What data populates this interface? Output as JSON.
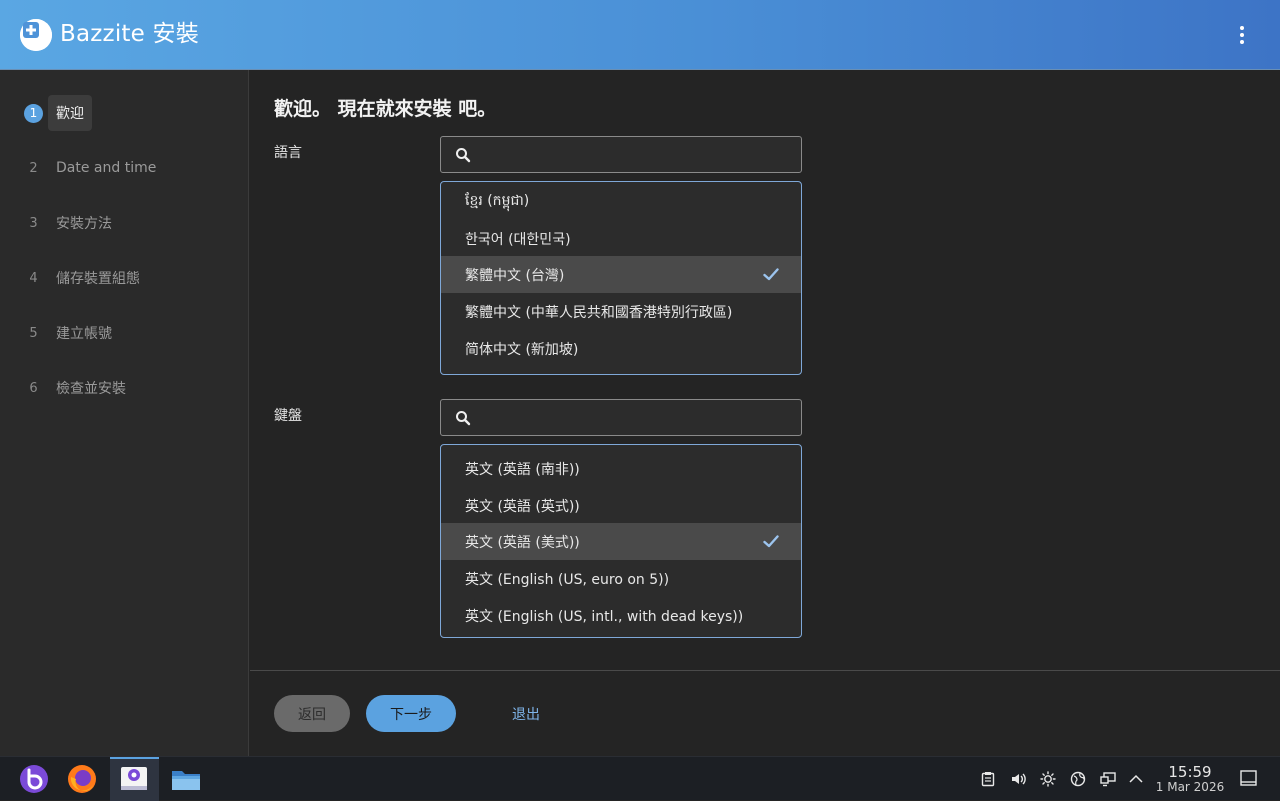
{
  "header": {
    "title": "Bazzite 安裝",
    "logo_icon": "bazzite-installer-logo",
    "menu_icon": "kebab-menu-icon",
    "accent": "#4a8fd6"
  },
  "sidebar": {
    "steps": [
      {
        "number": "1",
        "label": "歡迎",
        "active": true
      },
      {
        "number": "2",
        "label": "Date and time"
      },
      {
        "number": "3",
        "label": "安裝方法"
      },
      {
        "number": "4",
        "label": "儲存裝置組態"
      },
      {
        "number": "5",
        "label": "建立帳號"
      },
      {
        "number": "6",
        "label": "檢查並安裝"
      }
    ]
  },
  "main": {
    "welcome": "歡迎。 現在就來安裝 吧。",
    "language": {
      "label": "語言",
      "search_value": "",
      "items": [
        {
          "label": "ខ្មែរ (កម្ពុជា)"
        },
        {
          "label": "한국어 (대한민국)"
        },
        {
          "label": "繁體中文 (台灣)",
          "selected": true
        },
        {
          "label": "繁體中文 (中華人民共和國香港特別行政區)"
        },
        {
          "label": "简体中文 (新加坡)"
        }
      ]
    },
    "keyboard": {
      "label": "鍵盤",
      "search_value": "",
      "items": [
        {
          "label": "英文 (英語 (南非))"
        },
        {
          "label": "英文 (英語 (英式))"
        },
        {
          "label": "英文 (英語 (美式))",
          "selected": true
        },
        {
          "label": "英文 (English (US, euro on 5))"
        },
        {
          "label": "英文 (English (US, intl., with dead keys))"
        }
      ]
    }
  },
  "footer": {
    "back_label": "返回",
    "next_label": "下一步",
    "quit_label": "退出"
  },
  "taskbar": {
    "apps": [
      "bazzite-menu-icon",
      "firefox-icon",
      "installer-icon",
      "file-manager-icon"
    ],
    "tray": [
      "clipboard-icon",
      "volume-icon",
      "brightness-icon",
      "network-globe-icon",
      "display-icon",
      "tray-expand-icon"
    ],
    "time": "15:59",
    "date": "1 Mar 2026"
  }
}
